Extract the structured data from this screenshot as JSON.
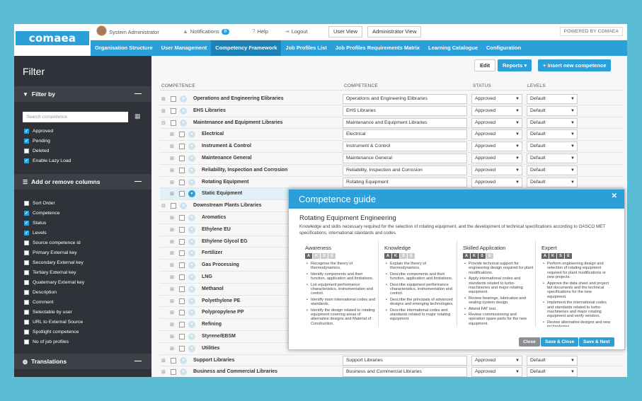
{
  "brand": {
    "logo": "comaea",
    "powered_by": "POWERED BY COMAEA"
  },
  "topbar": {
    "user": "System Administrator",
    "notifications": "Notifications",
    "notif_count": "0",
    "help": "Help",
    "logout": "Logout",
    "user_view": "User View",
    "admin_view": "Administrator View"
  },
  "nav": [
    "Organisation Structure",
    "User Management",
    "Competency Framework",
    "Job Profiles List",
    "Job Profiles Requirements Matrix",
    "Learning Catalogue",
    "Configuration"
  ],
  "nav_active": "Competency Framework",
  "sidebar": {
    "title": "Filter",
    "filter_by": "Filter by",
    "search_placeholder": "Search competence",
    "filters": [
      {
        "label": "Approved",
        "checked": true
      },
      {
        "label": "Pending",
        "checked": true
      },
      {
        "label": "Deleted",
        "checked": false
      },
      {
        "label": "Enable Lazy Load",
        "checked": true
      }
    ],
    "columns_title": "Add or remove columns",
    "columns": [
      {
        "label": "Sort Order",
        "checked": false
      },
      {
        "label": "Competence",
        "checked": true
      },
      {
        "label": "Status",
        "checked": true
      },
      {
        "label": "Levels",
        "checked": true
      },
      {
        "label": "Source competence id",
        "checked": false
      },
      {
        "label": "Primary External key",
        "checked": false
      },
      {
        "label": "Secondary External key",
        "checked": false
      },
      {
        "label": "Tertiary External key",
        "checked": false
      },
      {
        "label": "Quaternary External key",
        "checked": false
      },
      {
        "label": "Description",
        "checked": false
      },
      {
        "label": "Comment",
        "checked": false
      },
      {
        "label": "Selectable by user",
        "checked": false
      },
      {
        "label": "URL to External Source",
        "checked": false
      },
      {
        "label": "Spotlight competence",
        "checked": false
      },
      {
        "label": "No of job profiles",
        "checked": false
      }
    ],
    "translations": "Translations"
  },
  "actions": {
    "edit": "Edit",
    "reports": "Reports",
    "insert": "+ Insert new competence"
  },
  "table": {
    "headers": [
      "COMPETENCE",
      "COMPETENCE",
      "STATUS",
      "LEVELS"
    ],
    "rows": [
      {
        "name": "Operations and Engineering Elibraries",
        "value": "Operations and Engineering Elibraries",
        "status": "Approved",
        "level": "Default",
        "depth": 0
      },
      {
        "name": "EHS Libraries",
        "value": "EHS Libraries",
        "status": "Approved",
        "level": "Default",
        "depth": 0
      },
      {
        "name": "Maintenance and Equipment Libraries",
        "value": "Maintenance and Equipment Libraries",
        "status": "Approved",
        "level": "Default",
        "depth": 0
      },
      {
        "name": "Electrical",
        "value": "Electrical",
        "status": "Approved",
        "level": "Default",
        "depth": 1
      },
      {
        "name": "Instrument & Control",
        "value": "Instrument & Control",
        "status": "Approved",
        "level": "Default",
        "depth": 1
      },
      {
        "name": "Maintenance General",
        "value": "Maintenance General",
        "status": "Approved",
        "level": "Default",
        "depth": 1
      },
      {
        "name": "Reliability, Inspection and Corrosion",
        "value": "Reliability, Inspection and Corrosion",
        "status": "Approved",
        "level": "Default",
        "depth": 1
      },
      {
        "name": "Rotating Equipment",
        "value": "Rotating Equipment",
        "status": "Approved",
        "level": "Default",
        "depth": 1
      },
      {
        "name": "Static Equipment",
        "value": "",
        "status": "",
        "level": "",
        "depth": 1,
        "highlight": true
      },
      {
        "name": "Downstream Plants Libraries",
        "value": "",
        "status": "",
        "level": "",
        "depth": 0
      },
      {
        "name": "Aromatics",
        "value": "",
        "status": "",
        "level": "",
        "depth": 1
      },
      {
        "name": "Ethylene EU",
        "value": "",
        "status": "",
        "level": "",
        "depth": 1
      },
      {
        "name": "Ethylene Glycol EG",
        "value": "",
        "status": "",
        "level": "",
        "depth": 1
      },
      {
        "name": "Fertilizer",
        "value": "",
        "status": "",
        "level": "",
        "depth": 1
      },
      {
        "name": "Gas Processing",
        "value": "",
        "status": "",
        "level": "",
        "depth": 1
      },
      {
        "name": "LNG",
        "value": "",
        "status": "",
        "level": "",
        "depth": 1
      },
      {
        "name": "Methanol",
        "value": "",
        "status": "",
        "level": "",
        "depth": 1
      },
      {
        "name": "Polyethylene PE",
        "value": "",
        "status": "",
        "level": "",
        "depth": 1
      },
      {
        "name": "Polypropylene PP",
        "value": "",
        "status": "",
        "level": "",
        "depth": 1
      },
      {
        "name": "Refining",
        "value": "",
        "status": "",
        "level": "",
        "depth": 1
      },
      {
        "name": "Styrene/EBSM",
        "value": "",
        "status": "",
        "level": "",
        "depth": 1
      },
      {
        "name": "Utilities",
        "value": "",
        "status": "",
        "level": "",
        "depth": 1
      },
      {
        "name": "Support Libraries",
        "value": "Support Libraries",
        "status": "Approved",
        "level": "Default",
        "depth": 0
      },
      {
        "name": "Business and Commercial Libraries",
        "value": "Business and Commercial Libraries",
        "status": "Approved",
        "level": "Default",
        "depth": 0
      }
    ]
  },
  "modal": {
    "title": "Competence guide",
    "subtitle": "Rotating Equipment Engineering",
    "description": "Knowledge and skills necessary required for the selection of rotating equipment, and the development of technical specifications according to GASCO MET specifications, international standards and codes.",
    "levels": [
      {
        "name": "Awareness",
        "active": 1,
        "items": [
          "Recognise the theory of thermodynamics.",
          "Identify components and their function, application and limitations.",
          "List equipment performance characteristics, instrumentation and control.",
          "Identify main international codes and standards.",
          "Identify the design related to rotating equipment covering areas of alternative designs and Material of Construction."
        ]
      },
      {
        "name": "Knowledge",
        "active": 2,
        "items": [
          "Explain the theory of thermodynamics.",
          "Describe components and their function, application and limitations.",
          "Describe equipment performance characteristics, instrumentation and control.",
          "Describe the principals of advanced designs and emerging technologies.",
          "Describe international codes and standards related to major rotating equipment."
        ]
      },
      {
        "name": "Skilled Application",
        "active": 3,
        "items": [
          "Provide technical support for engineering design required for plant modifications.",
          "Apply international codes and standards related to turbo-machineries and major rotating equipment.",
          "Review bearings, lubrication and sealing system design.",
          "Attend FAT test.",
          "Review commissioning and operation spare parts for the new equipment."
        ]
      },
      {
        "name": "Expert",
        "active": 4,
        "items": [
          "Perform engineering design and selection of rotating equipment required for plant modifications or new projects.",
          "Approve the data sheet and project bid documents and the technical specifications for the new equipment.",
          "Implement the international codes and standards related to turbo-machineries and major rotating equipment and verify vendors.",
          "Review alternative designs and new technologies."
        ]
      }
    ],
    "aks": [
      "A",
      "K",
      "S",
      "E"
    ],
    "btn_close": "Close",
    "btn_save_close": "Save & Close",
    "btn_save_next": "Save & Next"
  }
}
